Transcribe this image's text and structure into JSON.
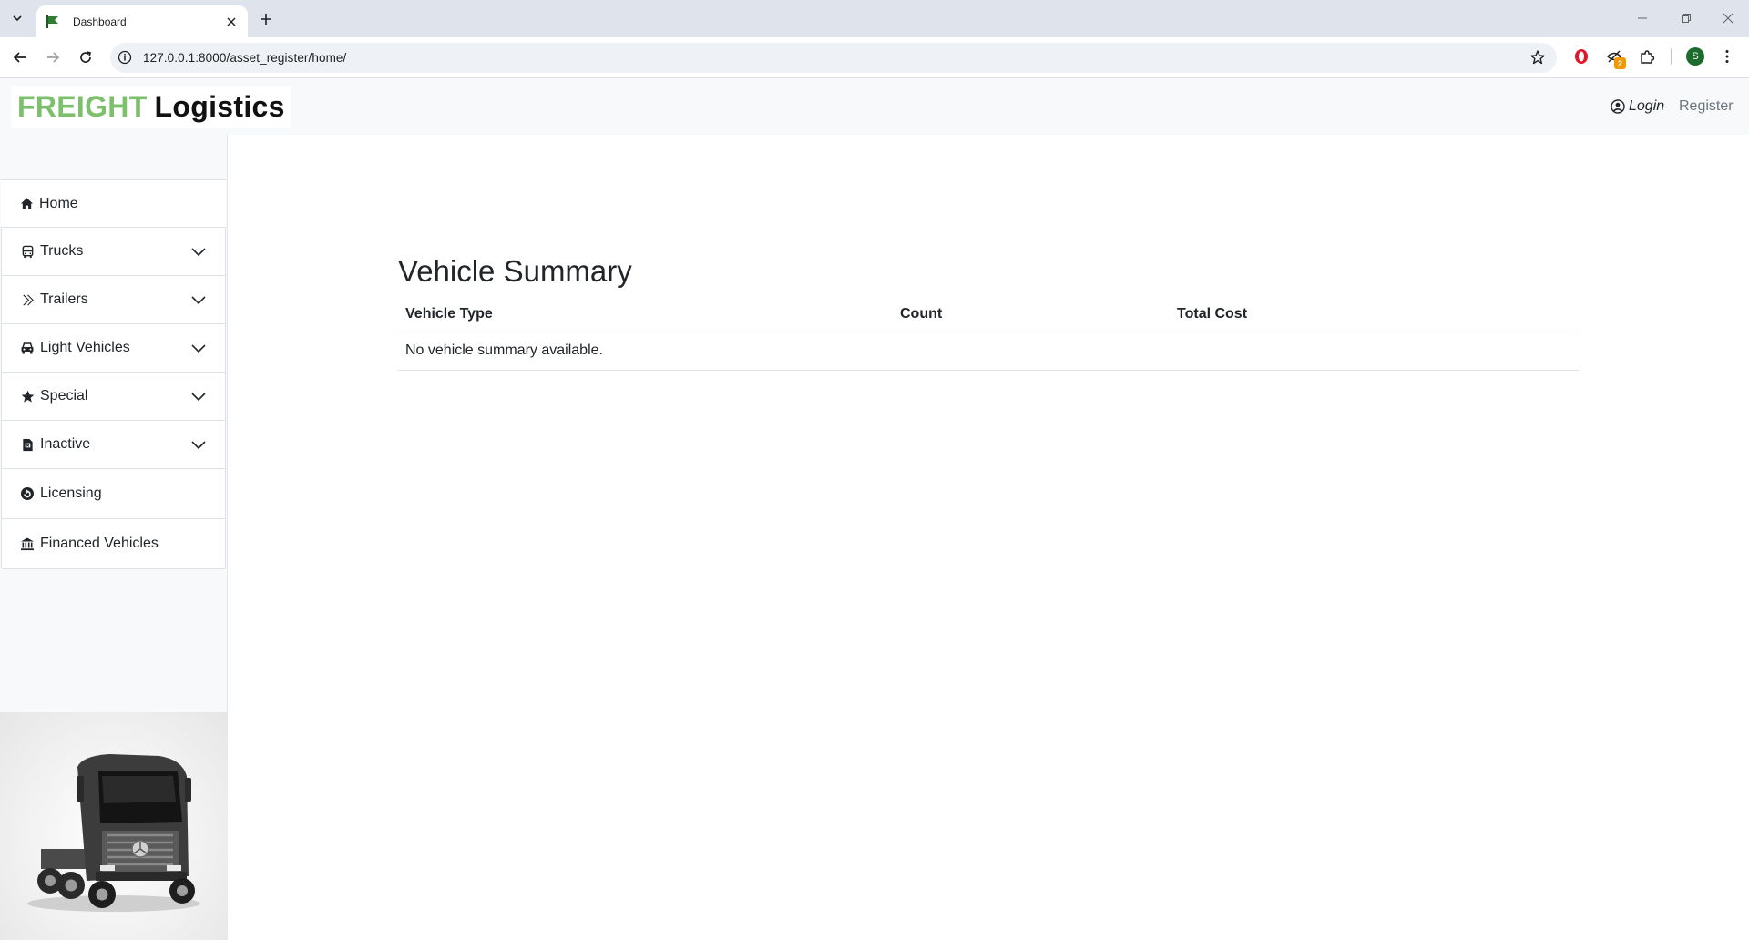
{
  "browser": {
    "tab_title": "Dashboard",
    "url": "127.0.0.1:8000/asset_register/home/",
    "extension_badge": "2",
    "profile_initial": "S"
  },
  "header": {
    "logo_part1": "FREIGHT",
    "logo_part2": "Logistics",
    "login_label": "Login",
    "register_label": "Register"
  },
  "sidebar": {
    "items": [
      {
        "label": "Home",
        "icon": "home-icon",
        "expandable": false
      },
      {
        "label": "Trucks",
        "icon": "bus-icon",
        "expandable": true
      },
      {
        "label": "Trailers",
        "icon": "double-chevron-right-icon",
        "expandable": true
      },
      {
        "label": "Light Vehicles",
        "icon": "car-icon",
        "expandable": true
      },
      {
        "label": "Special",
        "icon": "star-icon",
        "expandable": true
      },
      {
        "label": "Inactive",
        "icon": "file-icon",
        "expandable": true
      },
      {
        "label": "Licensing",
        "icon": "license-icon",
        "expandable": false
      },
      {
        "label": "Financed Vehicles",
        "icon": "bank-icon",
        "expandable": false
      }
    ]
  },
  "main": {
    "title": "Vehicle Summary",
    "table": {
      "columns": [
        "Vehicle Type",
        "Count",
        "Total Cost"
      ],
      "empty_message": "No vehicle summary available."
    }
  },
  "colors": {
    "brand_green": "#7cc06c",
    "sidebar_bg": "#f8f9fa"
  }
}
